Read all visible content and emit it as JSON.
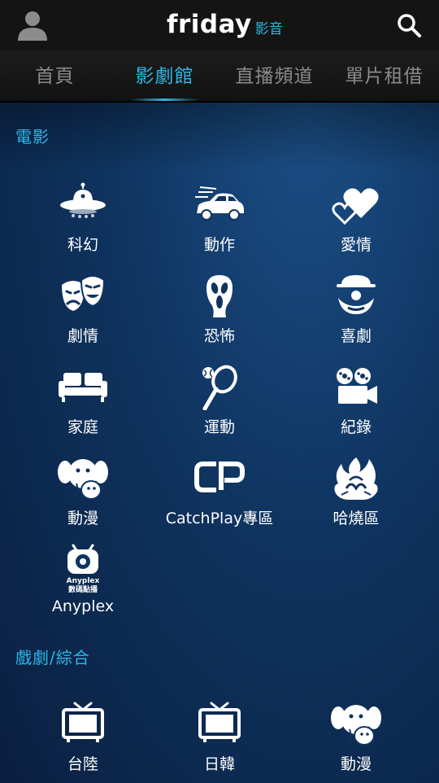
{
  "header": {
    "logo_text": "friday",
    "logo_sub": "影音"
  },
  "tabs": [
    {
      "label": "首頁"
    },
    {
      "label": "影劇館",
      "active": true
    },
    {
      "label": "直播頻道"
    },
    {
      "label": "單片租借"
    }
  ],
  "sections": [
    {
      "title": "電影",
      "items": [
        {
          "label": "科幻",
          "icon": "ufo-icon"
        },
        {
          "label": "動作",
          "icon": "car-icon"
        },
        {
          "label": "愛情",
          "icon": "hearts-icon"
        },
        {
          "label": "劇情",
          "icon": "drama-masks-icon"
        },
        {
          "label": "恐怖",
          "icon": "scream-mask-icon"
        },
        {
          "label": "喜劇",
          "icon": "clown-icon"
        },
        {
          "label": "家庭",
          "icon": "sofa-icon"
        },
        {
          "label": "運動",
          "icon": "racket-icon"
        },
        {
          "label": "紀錄",
          "icon": "film-camera-icon"
        },
        {
          "label": "動漫",
          "icon": "elephant-icon"
        },
        {
          "label": "CatchPlay專區",
          "icon": "catchplay-logo-icon"
        },
        {
          "label": "哈燒區",
          "icon": "flame-icon"
        },
        {
          "label": "Anyplex",
          "icon": "anyplex-logo-icon",
          "logo_text": [
            "Anyplex",
            "數碼點播"
          ]
        }
      ]
    },
    {
      "title": "戲劇/綜合",
      "items": [
        {
          "label": "台陸",
          "icon": "tv-icon"
        },
        {
          "label": "日韓",
          "icon": "tv-icon"
        },
        {
          "label": "動漫",
          "icon": "elephant-icon"
        }
      ]
    }
  ],
  "colors": {
    "accent": "#2eb7e7",
    "topbar": "#141414",
    "background": "#0f3460"
  }
}
